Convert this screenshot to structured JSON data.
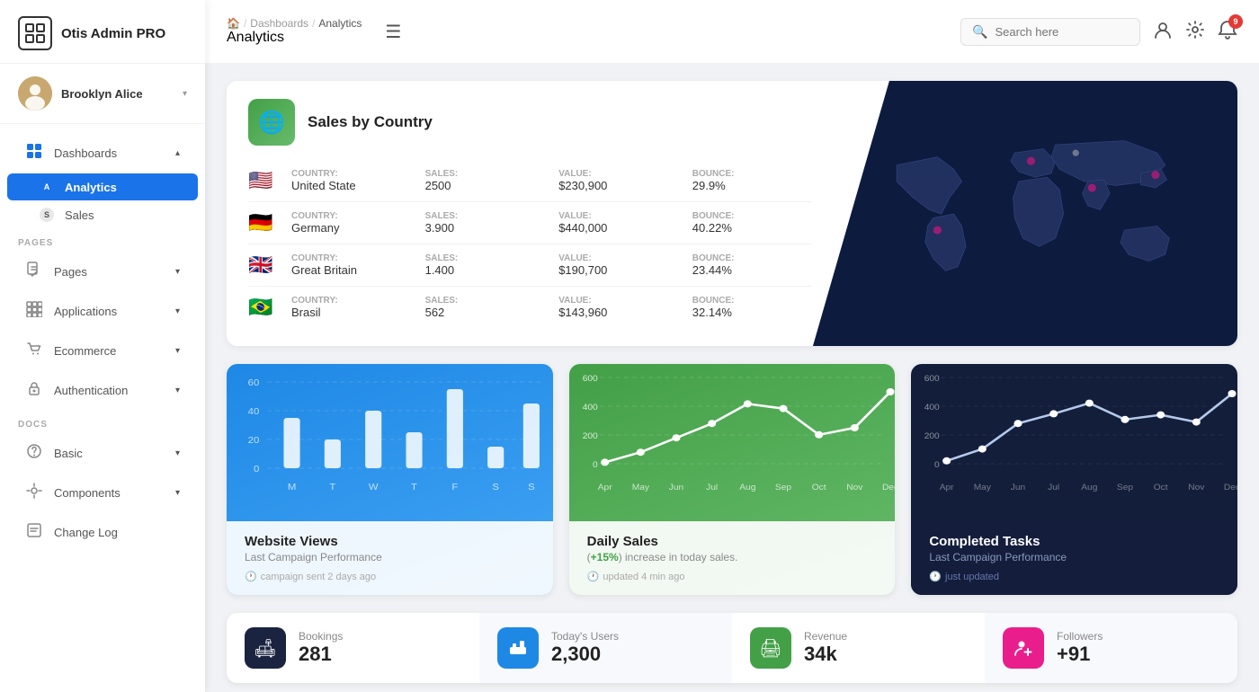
{
  "app": {
    "name": "Otis Admin PRO"
  },
  "user": {
    "name": "Brooklyn Alice"
  },
  "sidebar": {
    "dashboards_label": "Dashboards",
    "analytics_label": "Analytics",
    "sales_label": "Sales",
    "pages_section": "PAGES",
    "docs_section": "DOCS",
    "pages_label": "Pages",
    "applications_label": "Applications",
    "ecommerce_label": "Ecommerce",
    "authentication_label": "Authentication",
    "basic_label": "Basic",
    "components_label": "Components",
    "changelog_label": "Change Log"
  },
  "header": {
    "home_icon": "🏠",
    "breadcrumb_sep": "/",
    "dashboards_bc": "Dashboards",
    "analytics_bc": "Analytics",
    "page_title": "Analytics",
    "search_placeholder": "Search here"
  },
  "sales_country": {
    "title": "Sales by Country",
    "rows": [
      {
        "flag": "🇺🇸",
        "country_label": "Country:",
        "country": "United State",
        "sales_label": "Sales:",
        "sales": "2500",
        "value_label": "Value:",
        "value": "$230,900",
        "bounce_label": "Bounce:",
        "bounce": "29.9%"
      },
      {
        "flag": "🇩🇪",
        "country_label": "Country:",
        "country": "Germany",
        "sales_label": "Sales:",
        "sales": "3.900",
        "value_label": "Value:",
        "value": "$440,000",
        "bounce_label": "Bounce:",
        "bounce": "40.22%"
      },
      {
        "flag": "🇬🇧",
        "country_label": "Country:",
        "country": "Great Britain",
        "sales_label": "Sales:",
        "sales": "1.400",
        "value_label": "Value:",
        "value": "$190,700",
        "bounce_label": "Bounce:",
        "bounce": "23.44%"
      },
      {
        "flag": "🇧🇷",
        "country_label": "Country:",
        "country": "Brasil",
        "sales_label": "Sales:",
        "sales": "562",
        "value_label": "Value:",
        "value": "$143,960",
        "bounce_label": "Bounce:",
        "bounce": "32.14%"
      }
    ]
  },
  "chart1": {
    "title": "Website Views",
    "subtitle": "Last Campaign Performance",
    "footer": "campaign sent 2 days ago",
    "y_labels": [
      "60",
      "40",
      "20",
      "0"
    ],
    "x_labels": [
      "M",
      "T",
      "W",
      "T",
      "F",
      "S",
      "S"
    ],
    "bars": [
      35,
      20,
      40,
      25,
      55,
      15,
      45
    ]
  },
  "chart2": {
    "title": "Daily Sales",
    "subtitle": "(+15%) increase in today sales.",
    "highlight": "+15%",
    "footer": "updated 4 min ago",
    "y_labels": [
      "600",
      "400",
      "200",
      "0"
    ],
    "x_labels": [
      "Apr",
      "May",
      "Jun",
      "Jul",
      "Aug",
      "Sep",
      "Oct",
      "Nov",
      "Dec"
    ],
    "points": [
      10,
      80,
      180,
      280,
      420,
      390,
      200,
      250,
      500
    ]
  },
  "chart3": {
    "title": "Completed Tasks",
    "subtitle": "Last Campaign Performance",
    "footer": "just updated",
    "y_labels": [
      "600",
      "400",
      "200",
      "0"
    ],
    "x_labels": [
      "Apr",
      "May",
      "Jun",
      "Jul",
      "Aug",
      "Sep",
      "Oct",
      "Nov",
      "Dec"
    ],
    "points": [
      20,
      100,
      280,
      350,
      420,
      310,
      340,
      290,
      490
    ]
  },
  "stats": [
    {
      "icon": "🛋",
      "icon_class": "stat-icon-dark",
      "label": "Bookings",
      "value": "281"
    },
    {
      "icon": "📊",
      "icon_class": "stat-icon-blue",
      "label": "Today's Users",
      "value": "2,300"
    },
    {
      "icon": "🖨",
      "icon_class": "stat-icon-green",
      "label": "Revenue",
      "value": "34k"
    },
    {
      "icon": "👤",
      "icon_class": "stat-icon-pink",
      "label": "Followers",
      "value": "+91"
    }
  ],
  "notif_count": "9"
}
